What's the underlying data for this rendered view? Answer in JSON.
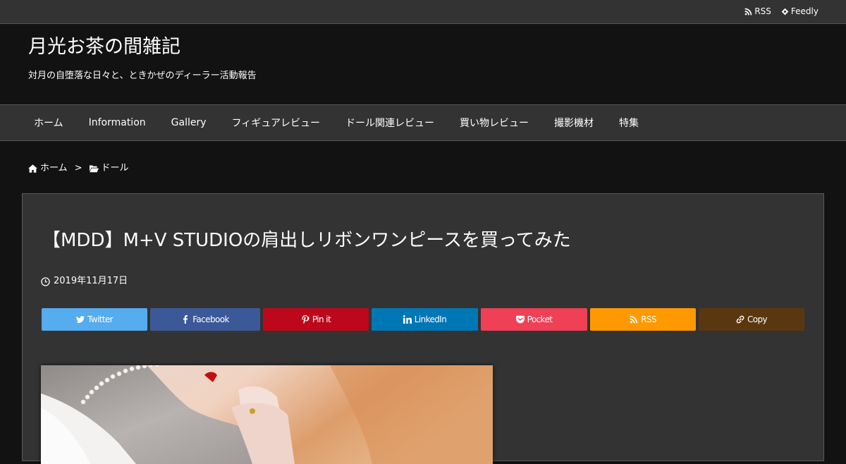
{
  "topbar": {
    "rss_label": "RSS",
    "feedly_label": "Feedly"
  },
  "header": {
    "title": "月光お茶の間雑記",
    "description": "対月の自堕落な日々と、ときかぜのディーラー活動報告"
  },
  "nav": {
    "items": [
      "ホーム",
      "Information",
      "Gallery",
      "フィギュアレビュー",
      "ドール関連レビュー",
      "買い物レビュー",
      "撮影機材",
      "特集"
    ]
  },
  "breadcrumb": {
    "home": "ホーム",
    "separator": ">",
    "category": "ドール"
  },
  "article": {
    "title": "【MDD】M+V STUDIOの肩出しリボンワンピースを買ってみた",
    "date": "2019年11月17日"
  },
  "share": {
    "twitter": {
      "label": "Twitter",
      "color": "#55acee",
      "icon": "twitter-icon"
    },
    "facebook": {
      "label": "Facebook",
      "color": "#3b5998",
      "icon": "facebook-icon"
    },
    "pinterest": {
      "label": "Pin it",
      "color": "#bd081c",
      "icon": "pinterest-icon"
    },
    "linkedin": {
      "label": "LinkedIn",
      "color": "#0077b5",
      "icon": "linkedin-icon"
    },
    "pocket": {
      "label": "Pocket",
      "color": "#ef4056",
      "icon": "pocket-icon"
    },
    "rss": {
      "label": "RSS",
      "color": "#fe9900",
      "icon": "rss-icon"
    },
    "copy": {
      "label": "Copy",
      "color": "#5b3710",
      "icon": "link-icon"
    }
  },
  "colors": {
    "background": "#121212",
    "bar": "#333333"
  }
}
